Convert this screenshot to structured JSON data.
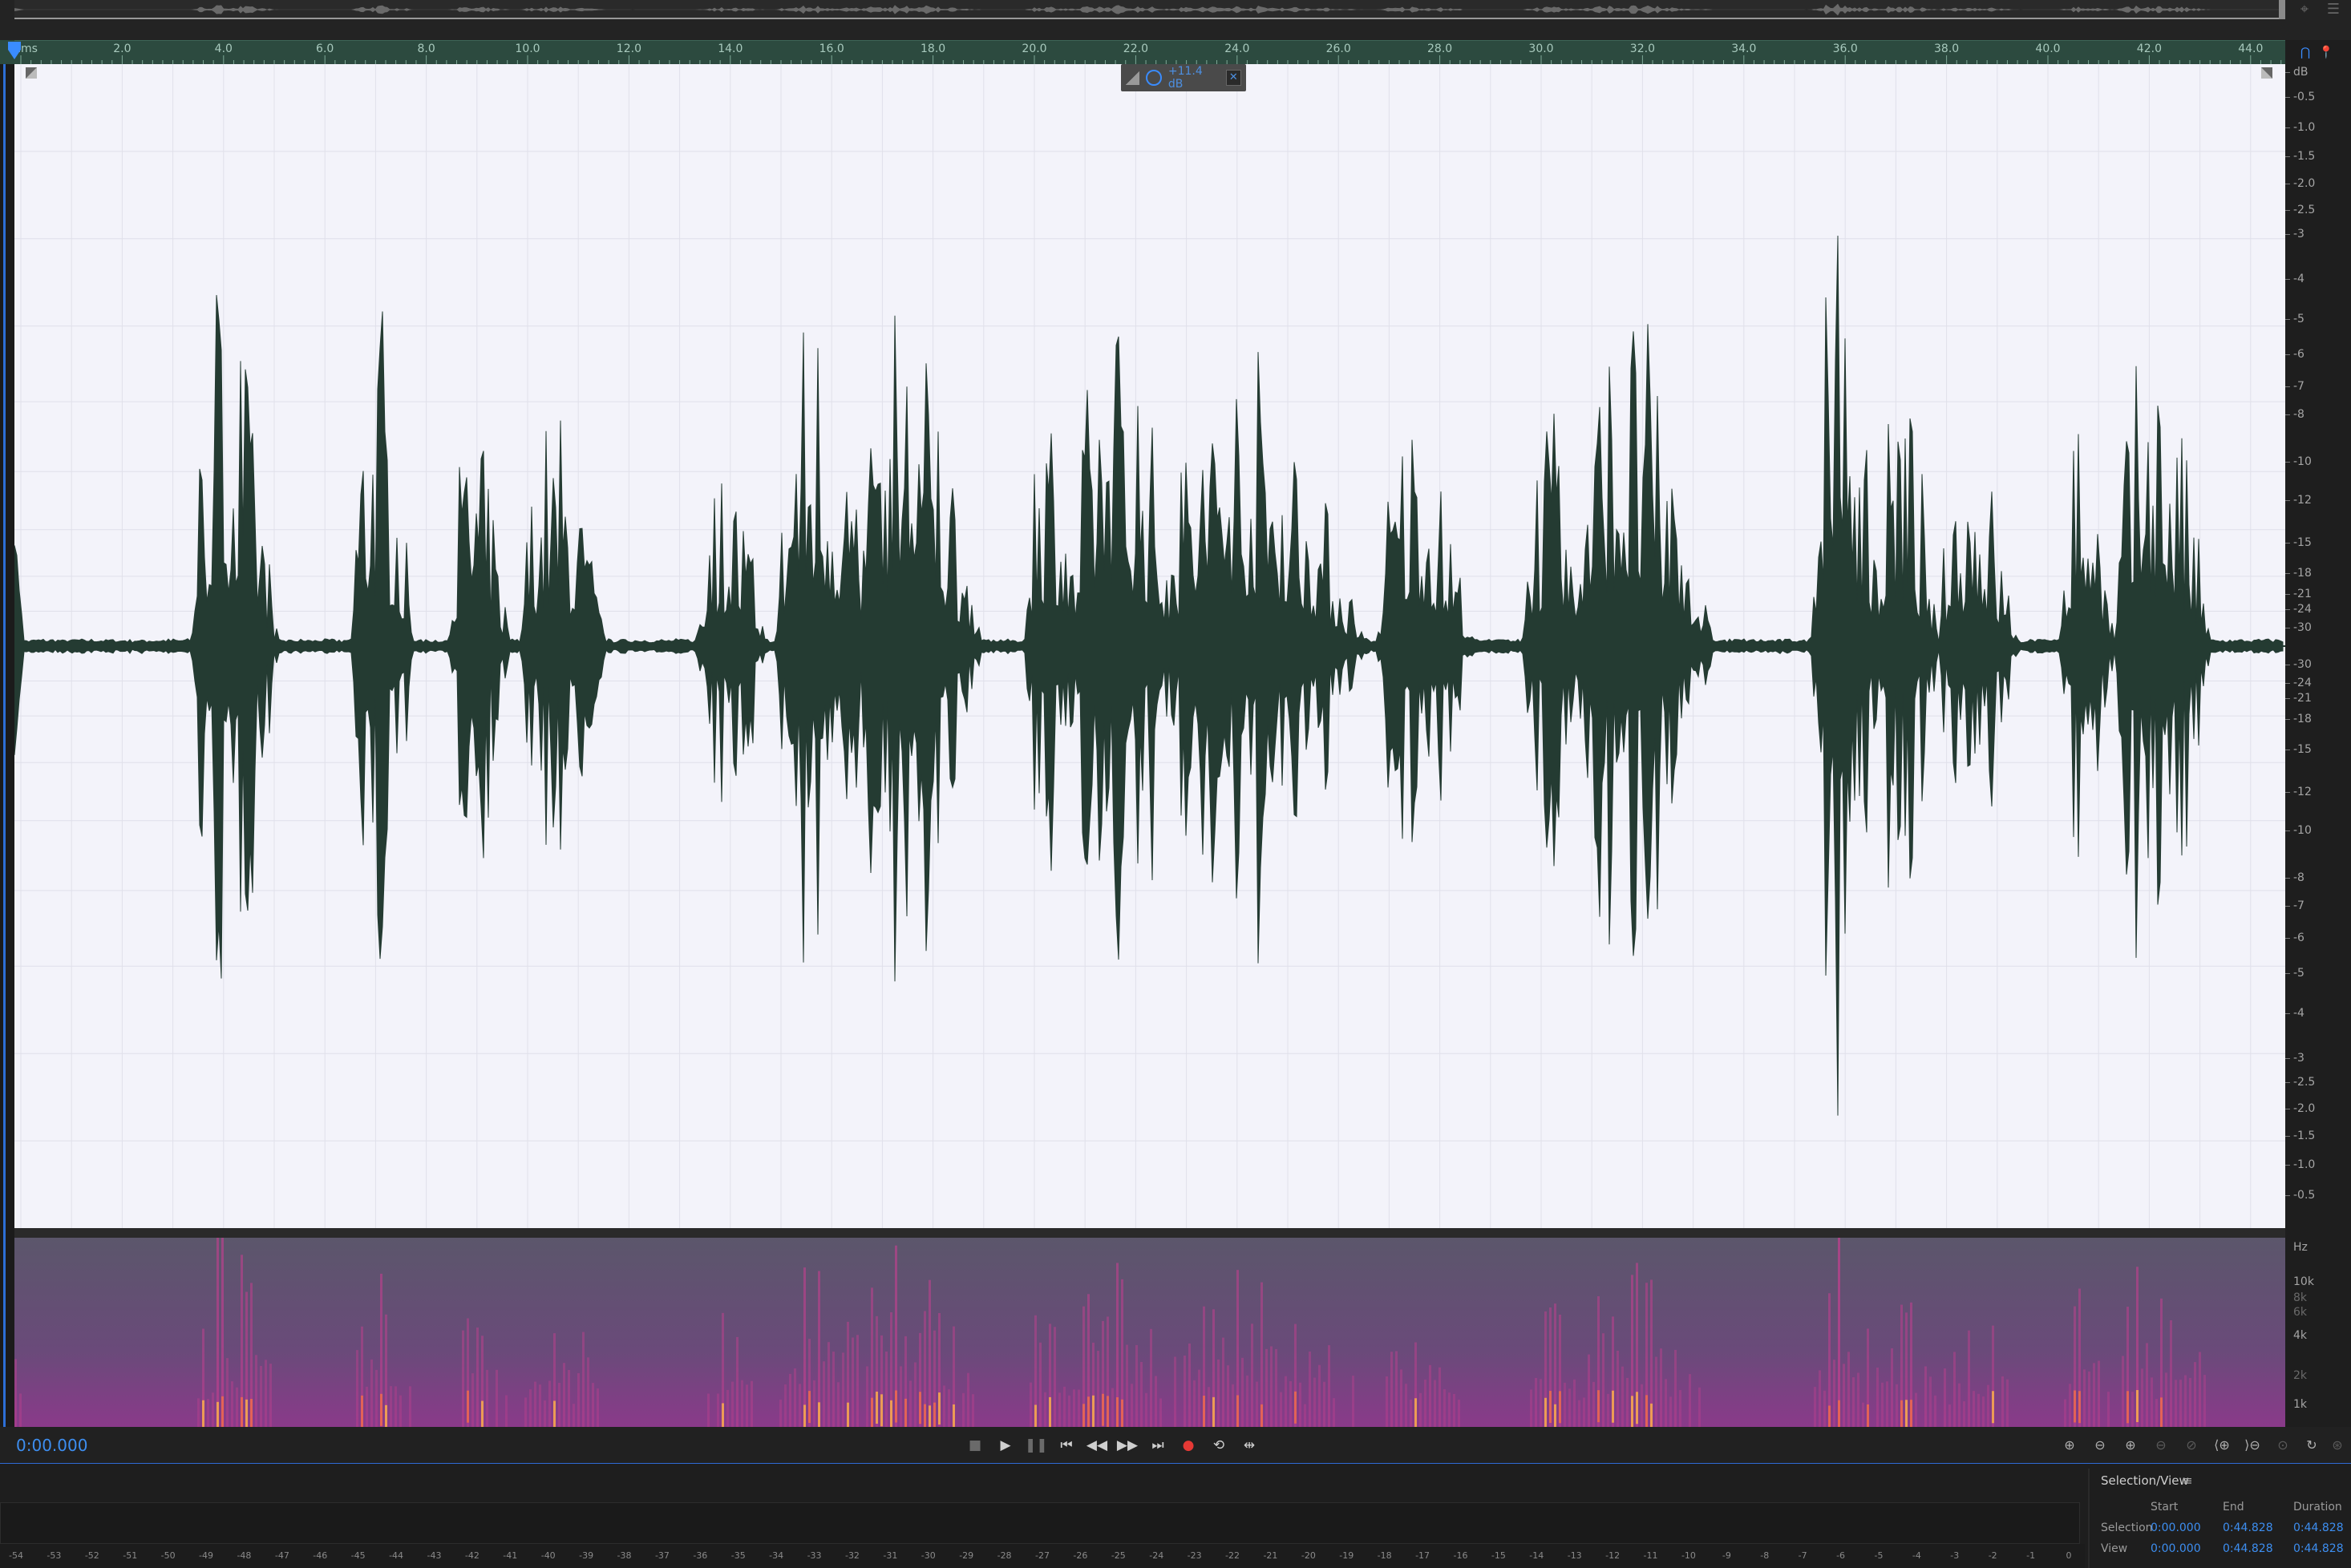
{
  "ruler": {
    "unit_label": "hms",
    "ticks": [
      "2.0",
      "4.0",
      "6.0",
      "8.0",
      "10.0",
      "12.0",
      "14.0",
      "16.0",
      "18.0",
      "20.0",
      "22.0",
      "24.0",
      "26.0",
      "28.0",
      "30.0",
      "32.0",
      "34.0",
      "36.0",
      "38.0",
      "40.0",
      "42.0",
      "44.0"
    ]
  },
  "hud": {
    "gain": "+11.4 dB"
  },
  "db_scale": {
    "unit": "dB",
    "top": [
      "-0.5",
      "-1.0",
      "-1.5",
      "-2.0",
      "-2.5",
      "-3",
      "-4",
      "-5",
      "-6",
      "-7",
      "-8",
      "-10",
      "-12",
      "-15",
      "-18",
      "-21",
      "-24",
      "-30"
    ],
    "bottom": [
      "-30",
      "-24",
      "-21",
      "-18",
      "-15",
      "-12",
      "-10",
      "-8",
      "-7",
      "-6",
      "-5",
      "-4",
      "-3",
      "-2.5",
      "-2.0",
      "-1.5",
      "-1.0",
      "-0.5"
    ]
  },
  "hz_scale": {
    "unit": "Hz",
    "labels": [
      "10k",
      "8k",
      "6k",
      "4k",
      "2k",
      "1k"
    ]
  },
  "colors": {
    "waveform": "#243b32",
    "wave_bg": "#f3f3fa",
    "ruler": "#2c4a3f",
    "accent": "#3d8ef0"
  },
  "transport": {
    "time": "0:00.000",
    "buttons": [
      {
        "name": "stop-button",
        "icon": "stop-icon",
        "glyph": "■"
      },
      {
        "name": "play-button",
        "icon": "play-icon",
        "glyph": "▶"
      },
      {
        "name": "pause-button",
        "icon": "pause-icon",
        "glyph": "❚❚"
      },
      {
        "name": "go-to-start-button",
        "icon": "skip-back-icon",
        "glyph": "⏮"
      },
      {
        "name": "rewind-button",
        "icon": "rewind-icon",
        "glyph": "◀◀"
      },
      {
        "name": "fast-forward-button",
        "icon": "fast-forward-icon",
        "glyph": "▶▶"
      },
      {
        "name": "go-to-end-button",
        "icon": "skip-forward-icon",
        "glyph": "⏭"
      },
      {
        "name": "record-button",
        "icon": "record-icon",
        "glyph": "●"
      },
      {
        "name": "loop-button",
        "icon": "loop-icon",
        "glyph": "⟲"
      },
      {
        "name": "skip-selection-button",
        "icon": "skip-selection-icon",
        "glyph": "⇹"
      }
    ],
    "zoom_buttons": [
      {
        "name": "zoom-in-amplitude-button",
        "icon": "zoom-in-amplitude-icon",
        "glyph": "⊕"
      },
      {
        "name": "zoom-out-amplitude-button",
        "icon": "zoom-out-amplitude-icon",
        "glyph": "⊖"
      },
      {
        "name": "zoom-in-time-button",
        "icon": "zoom-in-time-icon",
        "glyph": "⊕"
      },
      {
        "name": "zoom-out-time-button",
        "icon": "zoom-out-time-icon",
        "glyph": "⊖"
      },
      {
        "name": "zoom-out-full-button",
        "icon": "zoom-full-icon",
        "glyph": "⊘"
      },
      {
        "name": "zoom-in-selection-button",
        "icon": "zoom-selection-icon",
        "glyph": "⟨⊕"
      },
      {
        "name": "zoom-to-left-edge-button",
        "icon": "zoom-left-edge-icon",
        "glyph": "⟩⊖"
      },
      {
        "name": "zoom-to-right-edge-button",
        "icon": "zoom-right-edge-icon",
        "glyph": "⊙"
      },
      {
        "name": "zoom-reset-button",
        "icon": "zoom-reset-icon",
        "glyph": "↻"
      },
      {
        "name": "zoom-settings-button",
        "icon": "zoom-settings-icon",
        "glyph": "⊛"
      }
    ]
  },
  "selection_view": {
    "title": "Selection/View",
    "menu_icon": "≡",
    "headers": [
      "Start",
      "End",
      "Duration"
    ],
    "rows": [
      {
        "label": "Selection",
        "start": "0:00.000",
        "end": "0:44.828",
        "duration": "0:44.828"
      },
      {
        "label": "View",
        "start": "0:00.000",
        "end": "0:44.828",
        "duration": "0:44.828"
      }
    ]
  },
  "level_meter": {
    "labels": [
      "-54",
      "-53",
      "-52",
      "-51",
      "-50",
      "-49",
      "-48",
      "-47",
      "-46",
      "-45",
      "-44",
      "-43",
      "-42",
      "-41",
      "-40",
      "-39",
      "-38",
      "-37",
      "-36",
      "-35",
      "-34",
      "-33",
      "-32",
      "-31",
      "-30",
      "-29",
      "-28",
      "-27",
      "-26",
      "-25",
      "-24",
      "-23",
      "-22",
      "-21",
      "-20",
      "-19",
      "-18",
      "-17",
      "-16",
      "-15",
      "-14",
      "-13",
      "-12",
      "-11",
      "-10",
      "-9",
      "-8",
      "-7",
      "-6",
      "-5",
      "-4",
      "-3",
      "-2",
      "-1",
      "0"
    ]
  }
}
